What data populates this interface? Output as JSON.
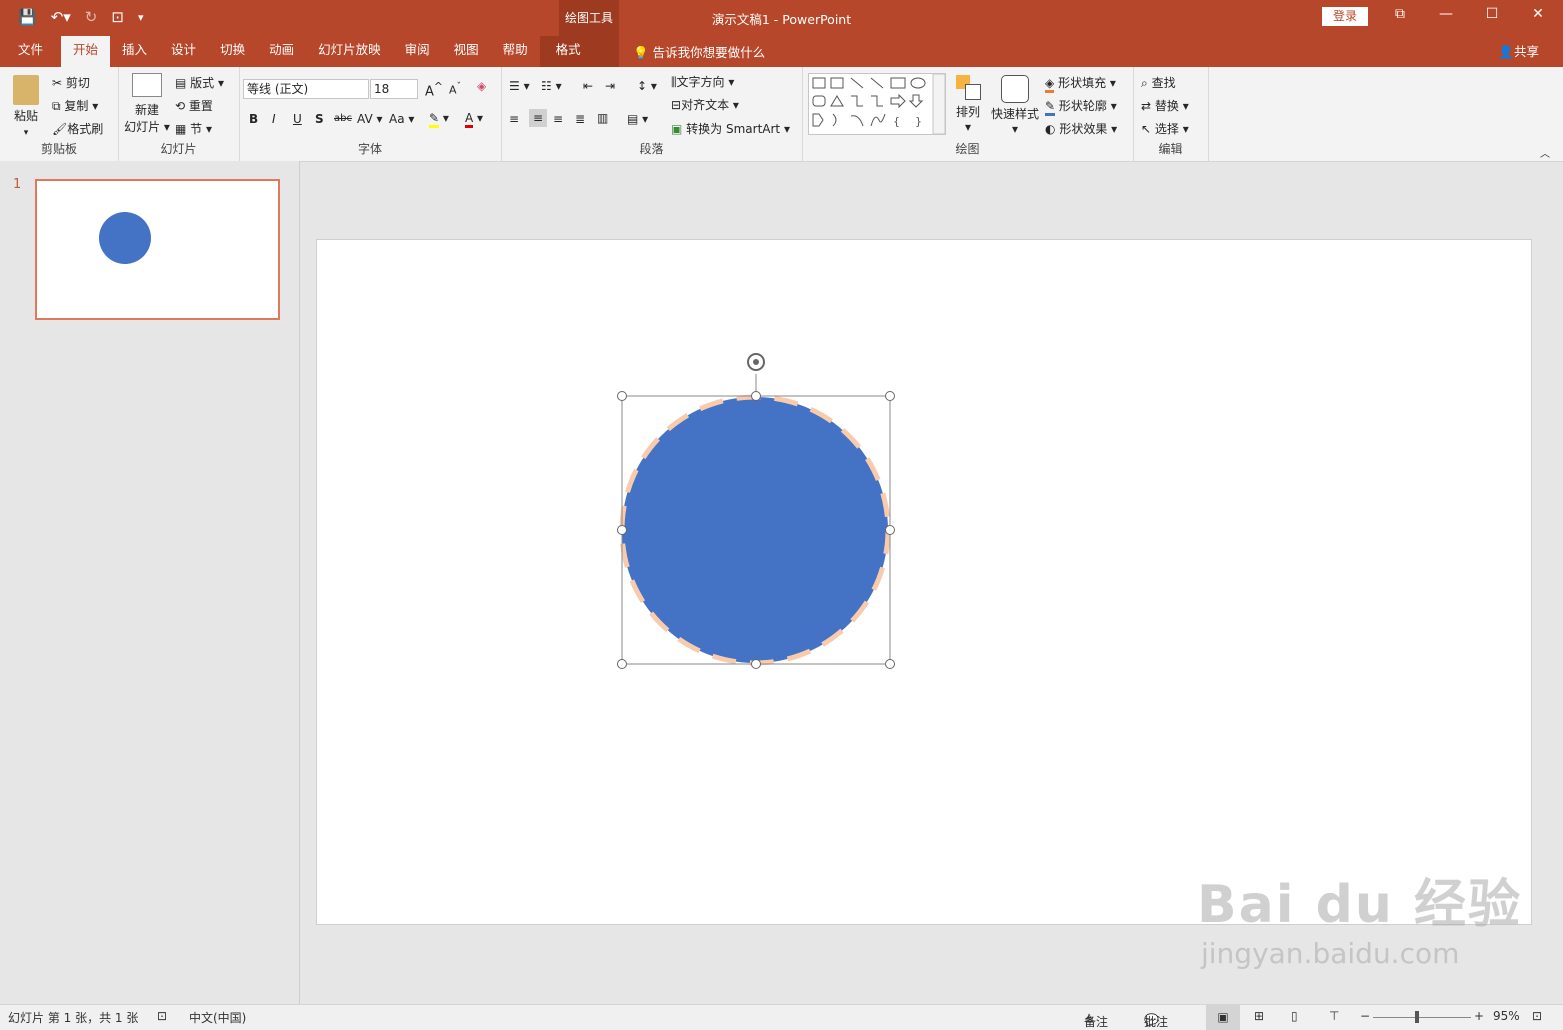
{
  "app": {
    "doc_title": "演示文稿1  -  PowerPoint",
    "context_group": "绘图工具",
    "login": "登录",
    "tell_me": "告诉我你想要做什么",
    "share": "共享"
  },
  "qat": [
    "save-icon",
    "undo-icon",
    "redo-icon",
    "start-from-beginning-icon",
    "customize-icon"
  ],
  "tabs": [
    "文件",
    "开始",
    "插入",
    "设计",
    "切换",
    "动画",
    "幻灯片放映",
    "审阅",
    "视图",
    "帮助",
    "格式"
  ],
  "active_tab": "开始",
  "ribbon": {
    "clipboard": {
      "label": "剪贴板",
      "paste": "粘贴",
      "cut": "剪切",
      "copy": "复制",
      "format_painter": "格式刷"
    },
    "slides": {
      "label": "幻灯片",
      "new_slide_1": "新建",
      "new_slide_2": "幻灯片",
      "layout": "版式",
      "reset": "重置",
      "section": "节"
    },
    "font": {
      "label": "字体",
      "font_name": "等线 (正文)",
      "font_size": "18",
      "bold": "B",
      "italic": "I",
      "underline": "U",
      "shadow": "S",
      "strike": "abc",
      "spacing": "AV",
      "case": "Aa",
      "color": "A"
    },
    "paragraph": {
      "label": "段落",
      "text_direction": "文字方向",
      "align_text": "对齐文本",
      "smartart": "转换为 SmartArt"
    },
    "drawing": {
      "label": "绘图",
      "arrange": "排列",
      "quick_styles": "快速样式",
      "shape_fill": "形状填充",
      "shape_outline": "形状轮廓",
      "shape_effects": "形状效果"
    },
    "editing": {
      "label": "编辑",
      "find": "查找",
      "replace": "替换",
      "select": "选择"
    }
  },
  "thumbnails": [
    {
      "number": "1"
    }
  ],
  "status": {
    "slide_info": "幻灯片 第 1 张，共 1 张",
    "language": "中文(中国)",
    "notes": "备注",
    "comments": "批注",
    "zoom": "95%"
  },
  "watermark": {
    "line1": "Bai du 经验",
    "line2": "jingyan.baidu.com"
  },
  "colors": {
    "accent": "#b7472a",
    "shape_fill": "#4472c4",
    "shape_outline": "#f8cbad"
  }
}
